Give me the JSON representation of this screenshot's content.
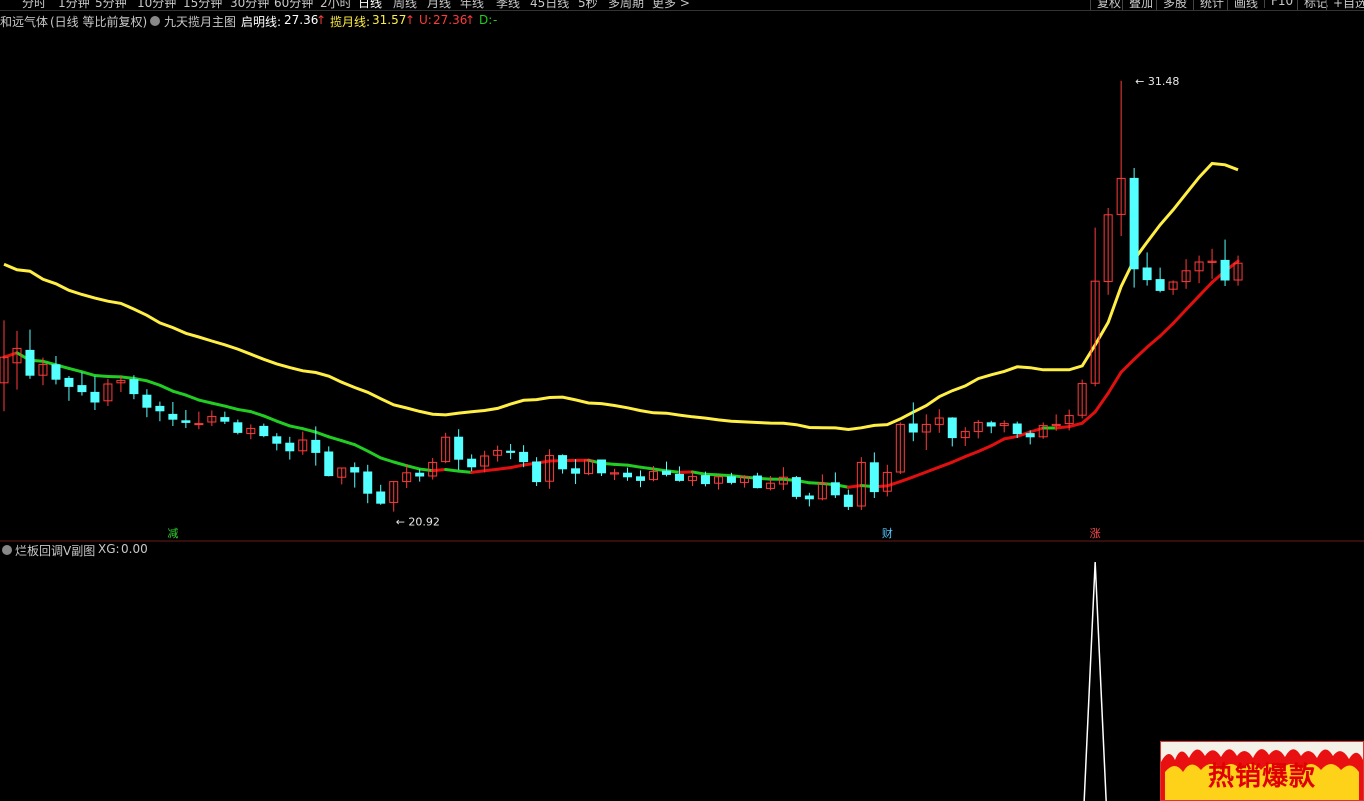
{
  "toolbar": {
    "periods": [
      "分时",
      "1分钟",
      "5分钟",
      "10分钟",
      "15分钟",
      "30分钟",
      "60分钟",
      "2小时",
      "日线",
      "周线",
      "月线",
      "年线",
      "季线",
      "45日线",
      "5秒",
      "多周期",
      "更多 >"
    ],
    "active_period": "日线",
    "right_buttons": [
      "复权",
      "叠加",
      "多股",
      "统计",
      "画线",
      "F10",
      "标记",
      "+自选"
    ]
  },
  "main_info": {
    "stock": "和远气体",
    "mode": "(日线 等比前复权)",
    "indicator_name": "九天揽月主图",
    "qiming_label": "启明线:",
    "qiming_value": "27.36",
    "lanyue_label": "揽月线:",
    "lanyue_value": "31.57",
    "u_label": "U:",
    "u_value": "27.36",
    "d_label": "D:",
    "d_value": "-",
    "arrow": "↑"
  },
  "sub_info": {
    "indicator_name": "烂板回调V副图",
    "xg_label": "XG:",
    "xg_value": "0.00"
  },
  "annotations": {
    "high_label": "31.48",
    "low_label": "20.92",
    "markers": [
      {
        "text": "减",
        "color": "#2fd12f",
        "bar": 13
      },
      {
        "text": "财",
        "color": "#56c7ff",
        "bar": 68
      },
      {
        "text": "涨",
        "color": "#ff4a4a",
        "bar": 84
      }
    ]
  },
  "badge": {
    "text": "热销爆款"
  },
  "colors": {
    "up": "#ff3b3b",
    "down": "#54ffff",
    "yellow_line": "#ffee44",
    "green_line": "#22cc22",
    "red_line": "#e01010",
    "background": "#000000"
  },
  "chart_data": {
    "type": "candlestick",
    "price_range": [
      20.5,
      32.5
    ],
    "ohlc": [
      [
        23.93,
        25.49,
        23.22,
        24.57
      ],
      [
        24.43,
        25.23,
        23.76,
        24.79
      ],
      [
        24.74,
        25.26,
        24.03,
        24.12
      ],
      [
        24.12,
        24.56,
        23.87,
        24.39
      ],
      [
        24.38,
        24.6,
        23.89,
        24.02
      ],
      [
        24.04,
        24.1,
        23.48,
        23.84
      ],
      [
        23.86,
        24.19,
        23.61,
        23.71
      ],
      [
        23.69,
        24.09,
        23.25,
        23.45
      ],
      [
        23.48,
        24.03,
        23.35,
        23.9
      ],
      [
        23.93,
        24.1,
        23.7,
        23.99
      ],
      [
        24.01,
        24.12,
        23.52,
        23.66
      ],
      [
        23.62,
        23.77,
        23.07,
        23.32
      ],
      [
        23.34,
        23.46,
        22.97,
        23.23
      ],
      [
        23.14,
        23.45,
        22.85,
        23.02
      ],
      [
        22.98,
        23.25,
        22.8,
        22.94
      ],
      [
        22.89,
        23.21,
        22.77,
        22.91
      ],
      [
        22.95,
        23.24,
        22.85,
        23.09
      ],
      [
        23.06,
        23.21,
        22.9,
        22.97
      ],
      [
        22.93,
        23.01,
        22.64,
        22.69
      ],
      [
        22.66,
        22.89,
        22.52,
        22.79
      ],
      [
        22.84,
        22.91,
        22.57,
        22.61
      ],
      [
        22.58,
        22.67,
        22.24,
        22.42
      ],
      [
        22.42,
        22.58,
        22.01,
        22.23
      ],
      [
        22.23,
        22.71,
        22.13,
        22.5
      ],
      [
        22.49,
        22.84,
        21.86,
        22.19
      ],
      [
        22.2,
        22.34,
        21.59,
        21.61
      ],
      [
        21.57,
        21.81,
        21.39,
        21.8
      ],
      [
        21.81,
        21.94,
        21.31,
        21.7
      ],
      [
        21.7,
        21.88,
        20.92,
        21.17
      ],
      [
        21.2,
        21.38,
        20.88,
        20.92
      ],
      [
        20.94,
        21.47,
        20.71,
        21.46
      ],
      [
        21.46,
        21.9,
        21.3,
        21.68
      ],
      [
        21.67,
        21.77,
        21.46,
        21.6
      ],
      [
        21.6,
        22.05,
        21.51,
        21.94
      ],
      [
        21.96,
        22.68,
        21.92,
        22.57
      ],
      [
        22.57,
        22.77,
        21.75,
        22.02
      ],
      [
        22.02,
        22.14,
        21.72,
        21.83
      ],
      [
        21.85,
        22.23,
        21.69,
        22.1
      ],
      [
        22.12,
        22.36,
        21.96,
        22.24
      ],
      [
        22.22,
        22.4,
        22.02,
        22.19
      ],
      [
        22.19,
        22.37,
        21.82,
        21.96
      ],
      [
        21.95,
        22.07,
        21.35,
        21.46
      ],
      [
        21.47,
        22.27,
        21.28,
        22.11
      ],
      [
        22.11,
        22.14,
        21.66,
        21.78
      ],
      [
        21.78,
        22.02,
        21.4,
        21.67
      ],
      [
        21.66,
        22.03,
        21.62,
        22.0
      ],
      [
        22.0,
        22.01,
        21.6,
        21.68
      ],
      [
        21.65,
        21.78,
        21.5,
        21.68
      ],
      [
        21.67,
        21.81,
        21.48,
        21.58
      ],
      [
        21.58,
        21.74,
        21.32,
        21.49
      ],
      [
        21.51,
        21.85,
        21.47,
        21.71
      ],
      [
        21.72,
        21.96,
        21.59,
        21.64
      ],
      [
        21.64,
        21.84,
        21.46,
        21.49
      ],
      [
        21.49,
        21.72,
        21.35,
        21.59
      ],
      [
        21.61,
        21.71,
        21.34,
        21.41
      ],
      [
        21.42,
        21.62,
        21.26,
        21.58
      ],
      [
        21.58,
        21.68,
        21.39,
        21.44
      ],
      [
        21.44,
        21.62,
        21.31,
        21.59
      ],
      [
        21.6,
        21.68,
        21.29,
        21.31
      ],
      [
        21.29,
        21.6,
        21.24,
        21.42
      ],
      [
        21.4,
        21.82,
        21.25,
        21.57
      ],
      [
        21.56,
        21.6,
        21.02,
        21.09
      ],
      [
        21.1,
        21.18,
        20.84,
        21.03
      ],
      [
        21.03,
        21.64,
        20.99,
        21.42
      ],
      [
        21.43,
        21.69,
        21.05,
        21.13
      ],
      [
        21.12,
        21.26,
        20.75,
        20.84
      ],
      [
        20.85,
        22.07,
        20.75,
        21.94
      ],
      [
        21.93,
        22.19,
        21.05,
        21.21
      ],
      [
        21.22,
        21.88,
        21.09,
        21.69
      ],
      [
        21.7,
        22.94,
        21.65,
        22.89
      ],
      [
        22.9,
        23.44,
        22.47,
        22.7
      ],
      [
        22.7,
        23.14,
        22.25,
        22.89
      ],
      [
        22.89,
        23.27,
        22.68,
        23.05
      ],
      [
        23.05,
        23.07,
        22.34,
        22.56
      ],
      [
        22.56,
        22.82,
        22.35,
        22.71
      ],
      [
        22.71,
        23.0,
        22.54,
        22.94
      ],
      [
        22.93,
        22.98,
        22.67,
        22.85
      ],
      [
        22.86,
        22.99,
        22.69,
        22.91
      ],
      [
        22.9,
        22.96,
        22.55,
        22.66
      ],
      [
        22.66,
        22.74,
        22.39,
        22.58
      ],
      [
        22.58,
        22.94,
        22.53,
        22.86
      ],
      [
        22.86,
        23.14,
        22.73,
        22.89
      ],
      [
        22.91,
        23.26,
        22.74,
        23.11
      ],
      [
        23.12,
        24.01,
        23.04,
        23.91
      ],
      [
        23.92,
        27.81,
        23.84,
        26.47
      ],
      [
        26.46,
        28.3,
        26.13,
        28.13
      ],
      [
        28.14,
        31.48,
        27.6,
        29.04
      ],
      [
        29.04,
        29.3,
        26.31,
        26.78
      ],
      [
        26.8,
        27.19,
        26.36,
        26.51
      ],
      [
        26.51,
        26.81,
        26.19,
        26.24
      ],
      [
        26.27,
        26.49,
        26.13,
        26.45
      ],
      [
        26.46,
        27.02,
        26.28,
        26.73
      ],
      [
        26.73,
        27.11,
        26.42,
        26.95
      ],
      [
        26.94,
        27.28,
        26.53,
        26.97
      ],
      [
        26.99,
        27.51,
        26.35,
        26.5
      ],
      [
        26.5,
        27.11,
        26.36,
        26.92
      ]
    ],
    "series": [
      {
        "name": "揽月线",
        "color": "#ffee44",
        "type": "line"
      },
      {
        "name": "启明线",
        "color": "#e01010",
        "type": "line"
      }
    ],
    "sub_chart": {
      "name": "XG",
      "spike_bar": 84,
      "spike_value": 1,
      "range": [
        0,
        1
      ]
    }
  }
}
